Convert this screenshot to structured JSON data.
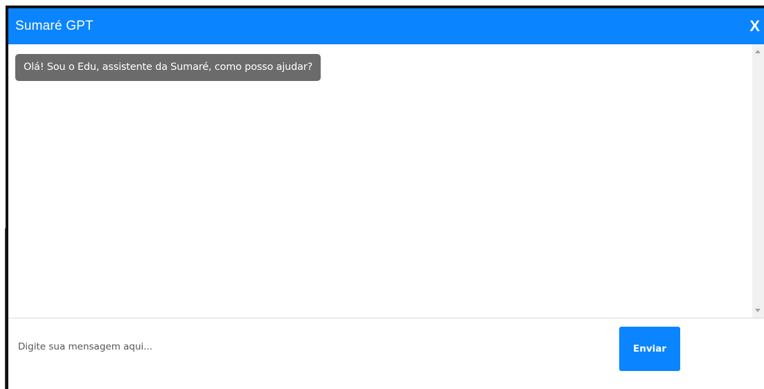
{
  "header": {
    "title": "Sumaré GPT",
    "close_label": "X"
  },
  "messages": [
    {
      "sender": "bot",
      "text": "Olá! Sou o Edu, assistente da Sumaré, como posso ajudar?"
    }
  ],
  "composer": {
    "placeholder": "Digite sua mensagem aqui...",
    "value": "",
    "send_label": "Enviar"
  },
  "colors": {
    "accent": "#0a84ff",
    "bot_bubble": "#6b6b6b"
  }
}
